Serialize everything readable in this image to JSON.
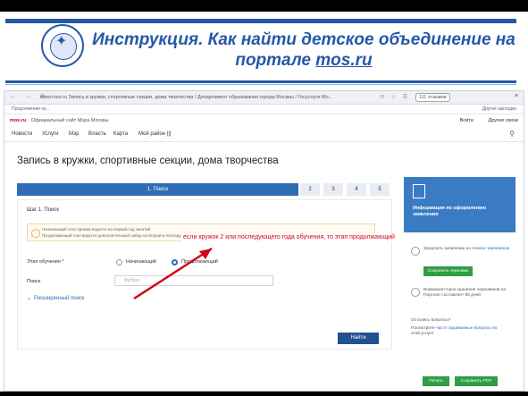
{
  "slide": {
    "title_line1": "Инструкция. Как найти детское объединение на",
    "title_line2_prefix": "портале ",
    "title_link": "mos.ru",
    "logo_icon": "dolphin-star-emblem-icon"
  },
  "browser": {
    "nav_icons": "← → ⟳",
    "url": "www.mos.ru   Запись в кружки, спортивные секции, дома творчества / Департамент образования города Москвы / Госуслуги Мо...",
    "downloads_badge": "111 отзывов",
    "menu_icon": "≡",
    "tools": "⟲ ☆ ☰",
    "bookmark_left": "Продолжение ну...",
    "bookmark_right": "Другие закладки"
  },
  "site": {
    "brand": "mos.ru",
    "brand_sub": "Официальный сайт Мэра Москвы",
    "login": "Войти",
    "other": "Другие связи",
    "nav": [
      "Новости",
      "Услуги",
      "Мэр",
      "Власть",
      "Карта",
      "Мой район |||"
    ],
    "search_icon": "search-icon"
  },
  "page": {
    "title": "Запись в кружки, спортивные секции, дома творчества",
    "steps": [
      "1. Поиск",
      "2",
      "3",
      "4",
      "5"
    ],
    "step_label": "Шаг 1. Поиск",
    "hint_line1": "Начинающий этап приема ведется на первый год занятий",
    "hint_line2": "Продолжающий этап ведется дополнительный набор на второй и последующие года занятий",
    "callout": "если кружок 2 или последующего года обучения, то этап продолжающий",
    "stage_label": "Этап обучения *",
    "radio_beginner": "Начинающий",
    "radio_continue": "Продолжающий",
    "search_label": "Поиск",
    "search_placeholder": "Футбол",
    "advanced": "Расширенный поиск",
    "find_button": "Найти"
  },
  "sidebar": {
    "info_title": "Информация по оформлению заявления",
    "upload_text": "Загрузить заявление из",
    "upload_link": "списка черновиков",
    "save_draft": "Сохранить черновик",
    "attention": "Внимание! Срок хранения черновиков на Портале составляет 90 дней",
    "questions": "Остались вопросы?",
    "faq_prefix": "Посмотрите",
    "faq_link": "часто задаваемые вопросы",
    "faq_suffix": "по этой услуге",
    "print": "Печать",
    "save_pdf": "Сохранить PDF"
  },
  "colors": {
    "title_blue": "#2458a8",
    "step_active": "#2e6db4",
    "callout_red": "#d0021b",
    "green": "#2f9e44",
    "sidebar_blue": "#3a7bc4"
  }
}
